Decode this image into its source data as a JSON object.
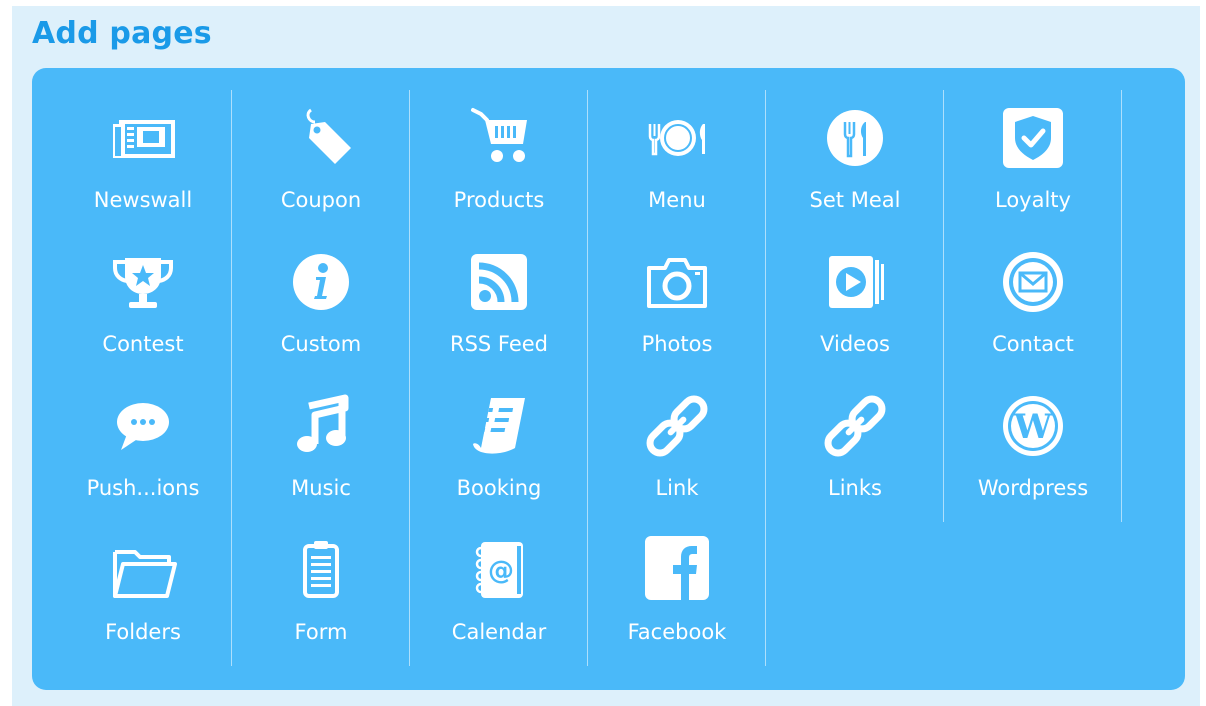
{
  "header": {
    "title": "Add pages"
  },
  "columns": [
    {
      "items": [
        {
          "label": "Newswall",
          "icon": "newspaper-icon"
        },
        {
          "label": "Contest",
          "icon": "trophy-icon"
        },
        {
          "label": "Push...ions",
          "icon": "speech-bubble-icon"
        },
        {
          "label": "Folders",
          "icon": "folder-icon"
        }
      ]
    },
    {
      "items": [
        {
          "label": "Coupon",
          "icon": "tag-icon"
        },
        {
          "label": "Custom",
          "icon": "info-icon"
        },
        {
          "label": "Music",
          "icon": "music-note-icon"
        },
        {
          "label": "Form",
          "icon": "clipboard-icon"
        }
      ]
    },
    {
      "items": [
        {
          "label": "Products",
          "icon": "shopping-cart-icon"
        },
        {
          "label": "RSS Feed",
          "icon": "rss-icon"
        },
        {
          "label": "Booking",
          "icon": "scroll-document-icon"
        },
        {
          "label": "Calendar",
          "icon": "address-book-icon"
        }
      ]
    },
    {
      "items": [
        {
          "label": "Menu",
          "icon": "plate-cutlery-icon"
        },
        {
          "label": "Photos",
          "icon": "camera-icon"
        },
        {
          "label": "Link",
          "icon": "chain-link-icon"
        },
        {
          "label": "Facebook",
          "icon": "facebook-icon"
        }
      ]
    },
    {
      "items": [
        {
          "label": "Set Meal",
          "icon": "fork-knife-circle-icon"
        },
        {
          "label": "Videos",
          "icon": "video-play-icon"
        },
        {
          "label": "Links",
          "icon": "chain-link-icon"
        }
      ]
    },
    {
      "items": [
        {
          "label": "Loyalty",
          "icon": "shield-check-icon"
        },
        {
          "label": "Contact",
          "icon": "envelope-circle-icon"
        },
        {
          "label": "Wordpress",
          "icon": "wordpress-icon"
        }
      ]
    }
  ],
  "colors": {
    "background": "#ddf0fb",
    "title": "#1a9ae8",
    "panel": "#4ab9f9",
    "foreground": "#ffffff"
  }
}
